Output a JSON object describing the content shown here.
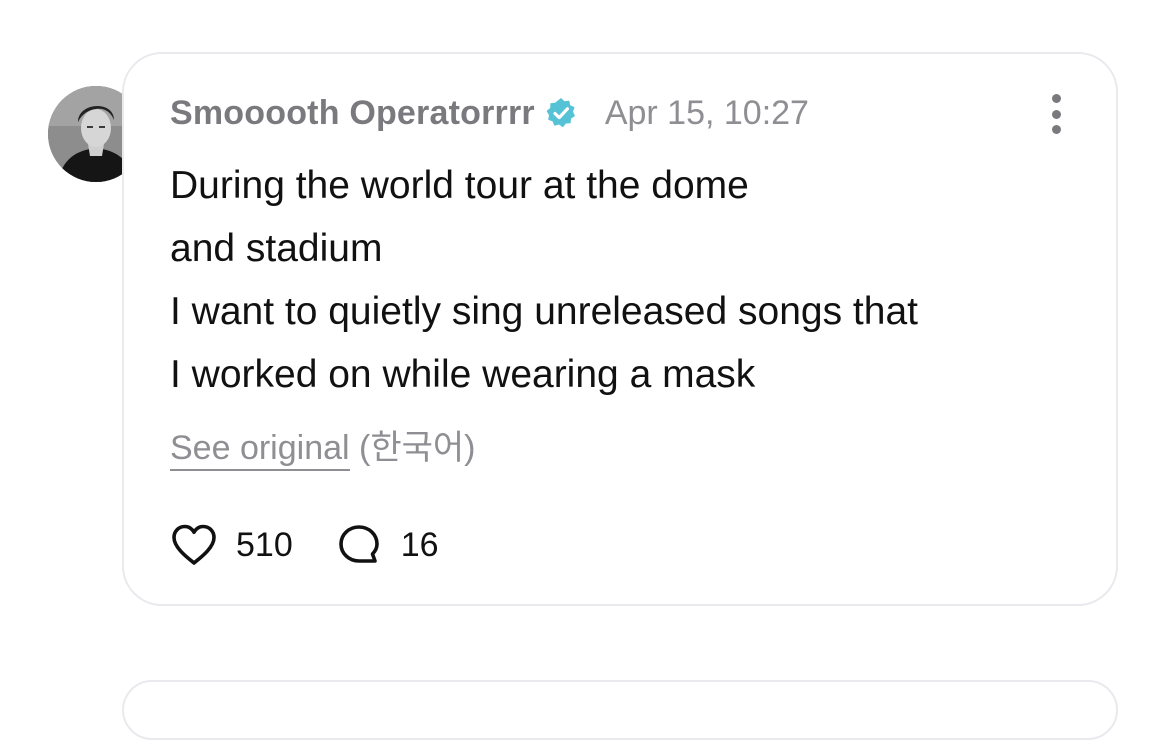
{
  "post": {
    "username": "Smooooth Operatorrrr",
    "timestamp": "Apr 15, 10:27",
    "body_lines": [
      "During the world tour at the dome",
      "and stadium",
      "I want to quietly sing unreleased songs that",
      "I worked on while wearing a mask"
    ],
    "see_original_label": "See original",
    "original_language": "(한국어)",
    "likes_count": "510",
    "replies_count": "16"
  },
  "icons": {
    "verified": "verified-badge-icon",
    "more": "more-vertical-icon",
    "like": "heart-icon",
    "reply": "speech-bubble-icon"
  },
  "colors": {
    "verified_badge": "#55c2d6",
    "secondary_text": "#8e8e93",
    "primary_text": "#111111",
    "card_border": "#e9e9ee"
  }
}
